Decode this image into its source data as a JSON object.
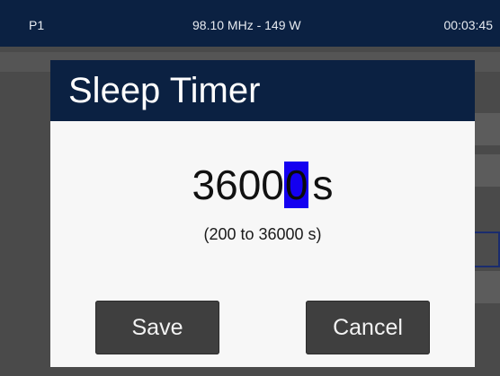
{
  "status_bar": {
    "preset": "P1",
    "frequency_power": "98.10 MHz - 149 W",
    "time": "00:03:45"
  },
  "dialog": {
    "title": "Sleep Timer",
    "value_prefix": "3600",
    "value_cursor_digit": "0",
    "unit": "s",
    "range": "(200 to 36000 s)",
    "save_label": "Save",
    "cancel_label": "Cancel"
  },
  "colors": {
    "title_bar": "#0b2142",
    "cursor_highlight": "#1400f0",
    "button": "#3f3f3f",
    "dialog_background": "#f7f7f7"
  }
}
